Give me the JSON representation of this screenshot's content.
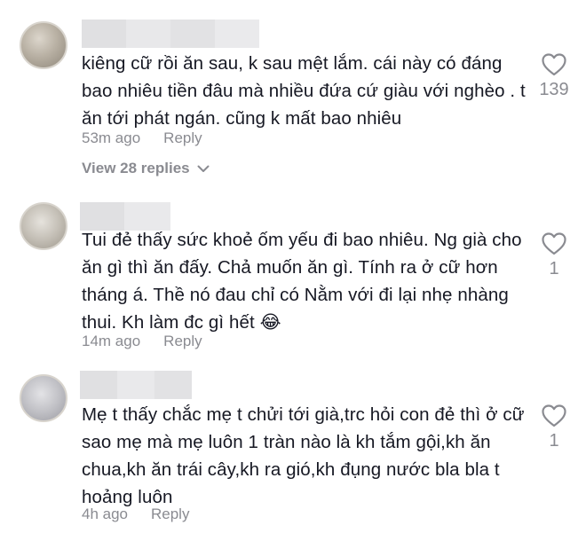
{
  "colors": {
    "text": "#161823",
    "meta": "#8a8b91",
    "name_blur": "#e3e3e5"
  },
  "comments": [
    {
      "text": "kiêng cữ rồi ăn sau, k sau mệt lắm. cái này có đáng bao nhiêu tiền đâu mà nhiều đứa cứ giàu với nghèo . t ăn tới phát ngán. cũng k mất bao nhiêu",
      "time": "53m ago",
      "reply_label": "Reply",
      "likes": "139",
      "view_replies": "View 28 replies"
    },
    {
      "text": "Tui đẻ thấy sức khoẻ ốm yếu đi bao nhiêu. Ng già cho ăn gì thì ăn đấy. Chả muốn ăn gì. Tính ra ở cữ hơn tháng á. Thề nó đau chỉ có Nằm với đi lại nhẹ nhàng thui. Kh làm đc gì hết 😂",
      "time": "14m ago",
      "reply_label": "Reply",
      "likes": "1"
    },
    {
      "text": "Mẹ t thấy chắc mẹ t chửi tới già,trc hỏi con đẻ thì ở cữ sao mẹ mà mẹ luôn 1 tràn nào là kh tắm gội,kh ăn chua,kh ăn trái cây,kh ra gió,kh đụng nước bla bla t hoảng luôn",
      "time": "4h ago",
      "reply_label": "Reply",
      "likes": "1"
    }
  ]
}
